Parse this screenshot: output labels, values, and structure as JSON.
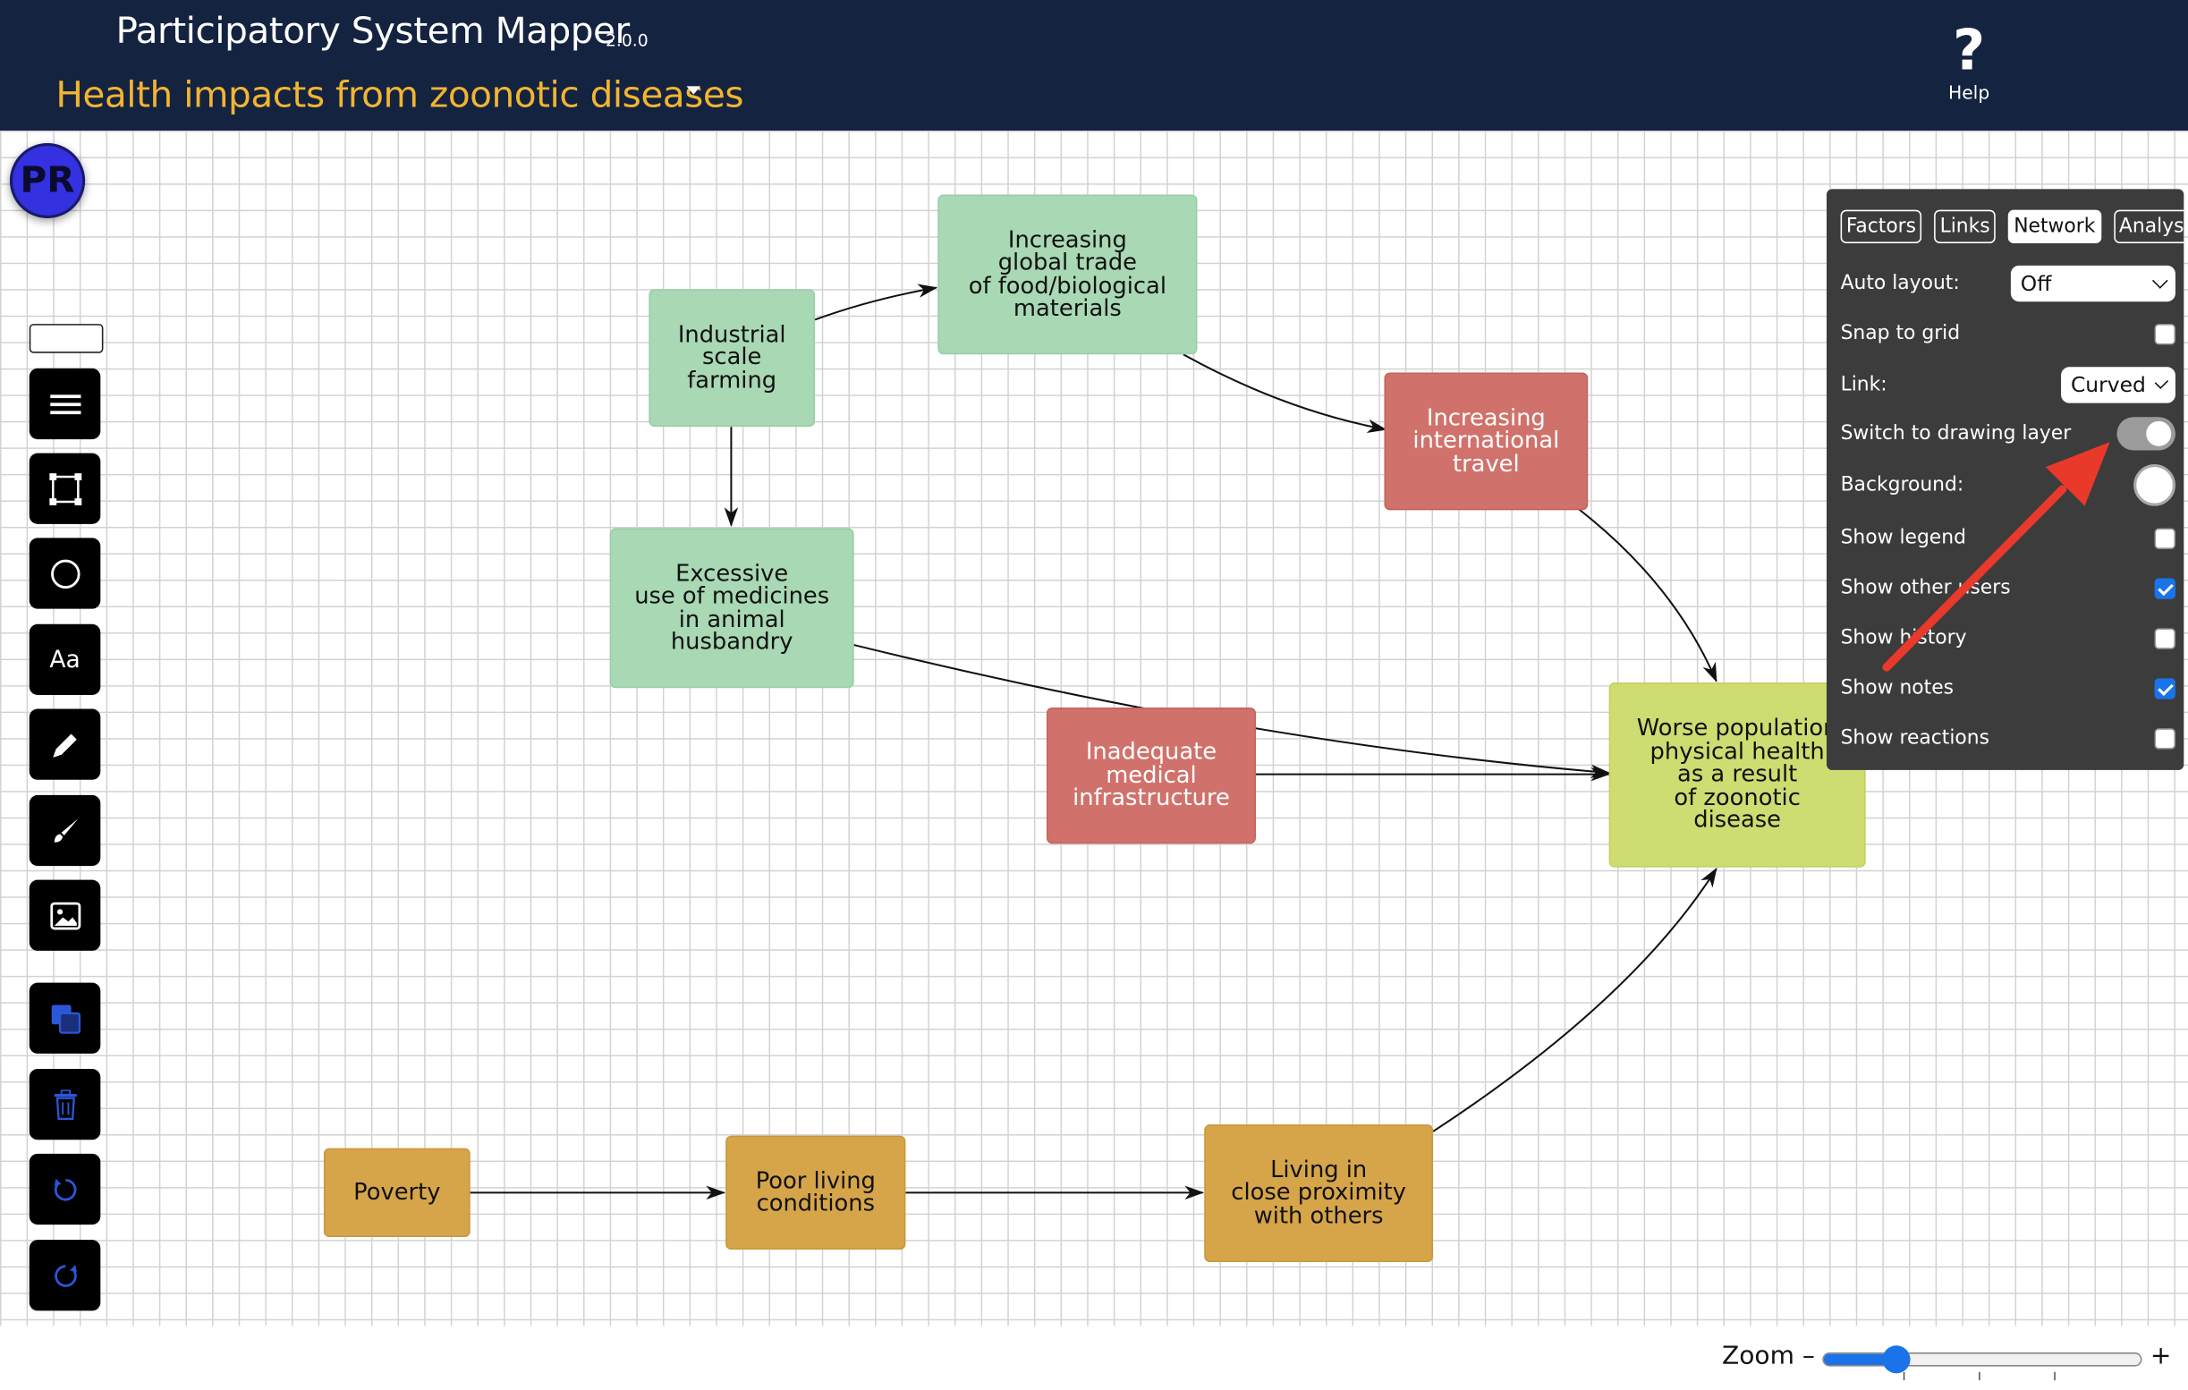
{
  "app": {
    "title": "Participatory System Mapper",
    "version": "2.0.0"
  },
  "map": {
    "title": "Health impacts from zoonotic diseases"
  },
  "help": {
    "icon": "?",
    "label": "Help"
  },
  "user": {
    "initials": "PR",
    "color": "#3331e0"
  },
  "toolbar": {
    "tools": [
      {
        "name": "hamburger-menu-icon"
      },
      {
        "name": "rectangle-select-icon"
      },
      {
        "name": "circle-shape-icon"
      },
      {
        "name": "text-tool",
        "label": "Aa"
      },
      {
        "name": "pencil-icon"
      },
      {
        "name": "brush-icon"
      },
      {
        "name": "image-icon"
      },
      {
        "name": "copy-icon"
      },
      {
        "name": "trash-icon"
      },
      {
        "name": "undo-icon"
      },
      {
        "name": "redo-icon"
      }
    ]
  },
  "nodes": {
    "industrial": "Industrial\nscale\nfarming",
    "global_trade": "Increasing\nglobal trade\nof food/biological\nmaterials",
    "travel": "Increasing\ninternational\ntravel",
    "medicines": "Excessive\nuse of medicines\nin animal\nhusbandry",
    "medical": "Inadequate\nmedical\ninfrastructure",
    "worse_health": "Worse population\nphysical health\nas a result\nof zoonotic\ndisease",
    "poverty": "Poverty",
    "poor_living": "Poor living\nconditions",
    "close_proximity": "Living in\nclose proximity\nwith others"
  },
  "node_colors": {
    "green": "#a8d8b4",
    "red": "#d0726b",
    "lime": "#cfdc71",
    "gold": "#d6a54a"
  },
  "panel": {
    "tabs": [
      "Factors",
      "Links",
      "Network",
      "Analysis"
    ],
    "active_tab": "Network",
    "auto_layout": {
      "label": "Auto layout:",
      "value": "Off"
    },
    "snap_to_grid": {
      "label": "Snap to grid",
      "checked": false
    },
    "link": {
      "label": "Link:",
      "value": "Curved"
    },
    "drawing_layer": {
      "label": "Switch to drawing layer",
      "on": true
    },
    "background": {
      "label": "Background:",
      "color": "#ffffff"
    },
    "show_legend": {
      "label": "Show legend",
      "checked": false
    },
    "show_other_users": {
      "label": "Show other users",
      "checked": true
    },
    "show_history": {
      "label": "Show history",
      "checked": false
    },
    "show_notes": {
      "label": "Show notes",
      "checked": true
    },
    "show_reactions": {
      "label": "Show reactions",
      "checked": false
    }
  },
  "zoom": {
    "label": "Zoom –",
    "plus": "+",
    "level": 0.23
  },
  "annotation": {
    "arrow_color": "#e8392b"
  }
}
